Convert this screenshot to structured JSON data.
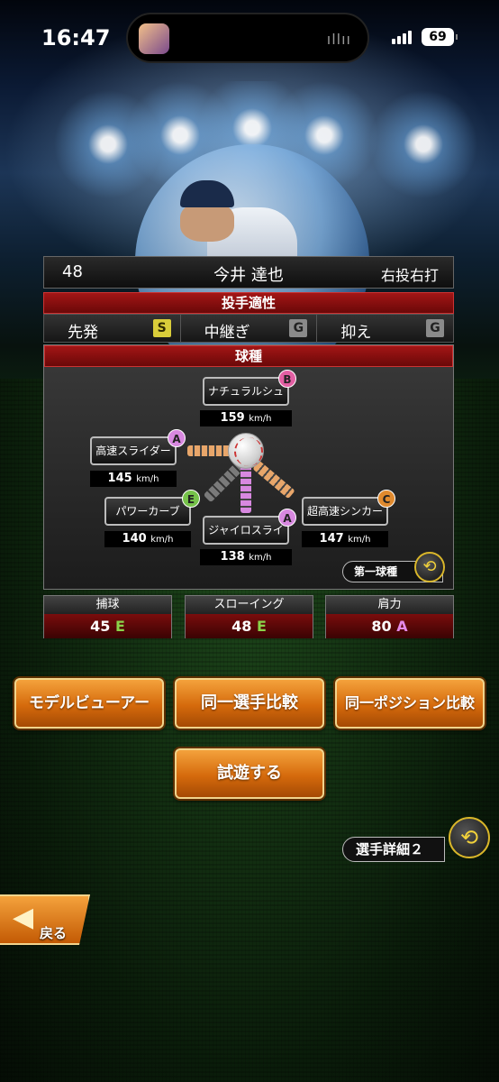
{
  "status_bar": {
    "time": "16:47",
    "battery": "69"
  },
  "player": {
    "number": "48",
    "name": "今井 達也",
    "handedness": "右投右打"
  },
  "aptitude": {
    "title": "投手適性",
    "items": [
      {
        "label": "先発",
        "grade": "S"
      },
      {
        "label": "中継ぎ",
        "grade": "G"
      },
      {
        "label": "抑え",
        "grade": "G"
      }
    ]
  },
  "pitches": {
    "title": "球種",
    "items": [
      {
        "name": "ナチュラルシュート",
        "grade": "B",
        "speed": "159",
        "unit": "km/h"
      },
      {
        "name": "高速スライダー",
        "grade": "A",
        "speed": "145",
        "unit": "km/h"
      },
      {
        "name": "パワーカーブ",
        "grade": "E",
        "speed": "140",
        "unit": "km/h"
      },
      {
        "name": "ジャイロスライダー",
        "grade": "A",
        "speed": "138",
        "unit": "km/h"
      },
      {
        "name": "超高速シンカー",
        "grade": "C",
        "speed": "147",
        "unit": "km/h"
      }
    ],
    "first_pitch_label": "第一球種"
  },
  "defense": [
    {
      "label": "捕球",
      "value": "45",
      "grade": "E"
    },
    {
      "label": "スローイング",
      "value": "48",
      "grade": "E"
    },
    {
      "label": "肩力",
      "value": "80",
      "grade": "A"
    }
  ],
  "buttons": {
    "model_viewer": "モデルビューアー",
    "same_player_compare": "同一選手比較",
    "same_position_compare": "同一ポジション比較",
    "try_play": "試遊する",
    "player_detail": "選手詳細２",
    "back": "戻る"
  },
  "icons": {
    "cycle": "cycle-arrows-icon",
    "back": "back-arrow-icon"
  }
}
